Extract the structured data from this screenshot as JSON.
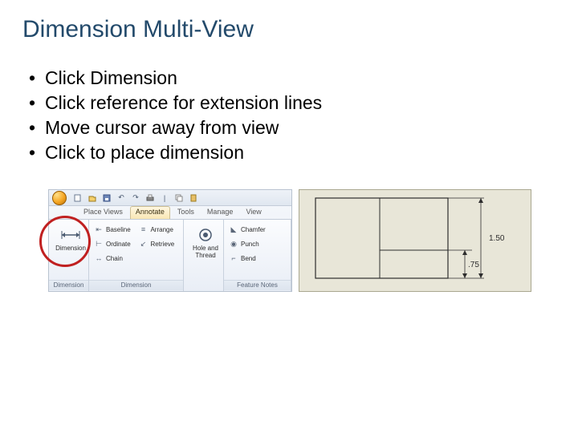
{
  "title": "Dimension Multi-View",
  "bullets": [
    "Click Dimension",
    "Click reference for extension lines",
    "Move cursor away from view",
    "Click to place dimension"
  ],
  "ribbon": {
    "tabs": [
      "Place Views",
      "Annotate",
      "Tools",
      "Manage",
      "View"
    ],
    "activeTab": "Annotate",
    "groups": {
      "g1": {
        "label": "Dimension",
        "big": "Dimension"
      },
      "g2": {
        "label": "Dimension",
        "items": [
          "Baseline",
          "Ordinate",
          "Chain",
          "Arrange",
          "Retrieve"
        ]
      },
      "g3": {
        "label": "",
        "big": "Hole and Thread"
      },
      "g4": {
        "label": "Feature Notes",
        "items": [
          "Chamfer",
          "Punch",
          "Bend"
        ]
      }
    }
  },
  "drawing": {
    "dims": {
      "d1": "1.50",
      "d2": ".75"
    }
  }
}
